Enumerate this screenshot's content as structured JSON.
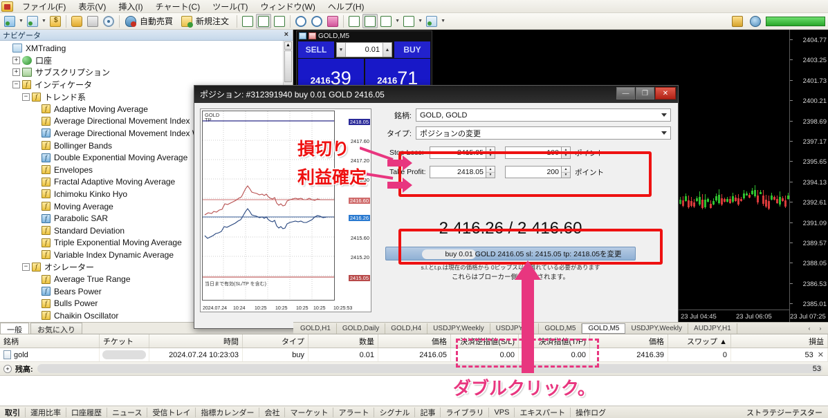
{
  "menu": {
    "items": [
      "ファイル(F)",
      "表示(V)",
      "挿入(I)",
      "チャート(C)",
      "ツール(T)",
      "ウィンドウ(W)",
      "ヘルプ(H)"
    ]
  },
  "toolbar": {
    "auto_trade_label": "自動売買",
    "new_order_label": "新規注文"
  },
  "navigator": {
    "title": "ナビゲータ",
    "close_label": "×",
    "items": [
      {
        "label": "XMTrading",
        "depth": 0,
        "icon": "xm-icon",
        "expander": ""
      },
      {
        "label": "口座",
        "depth": 1,
        "icon": "account-icon",
        "expander": "+"
      },
      {
        "label": "サブスクリプション",
        "depth": 1,
        "icon": "subscription-icon",
        "expander": "+"
      },
      {
        "label": "インディケータ",
        "depth": 1,
        "icon": "function-icon",
        "expander": "−"
      },
      {
        "label": "トレンド系",
        "depth": 2,
        "icon": "function-icon",
        "expander": "−"
      },
      {
        "label": "Adaptive Moving Average",
        "depth": 3,
        "icon": "function-icon",
        "expander": ""
      },
      {
        "label": "Average Directional Movement Index",
        "depth": 3,
        "icon": "function-icon",
        "expander": ""
      },
      {
        "label": "Average Directional Movement Index W",
        "depth": 3,
        "icon": "function-icon",
        "expander": ""
      },
      {
        "label": "Bollinger Bands",
        "depth": 3,
        "icon": "function-icon",
        "expander": ""
      },
      {
        "label": "Double Exponential Moving Average",
        "depth": 3,
        "icon": "function-icon",
        "expander": ""
      },
      {
        "label": "Envelopes",
        "depth": 3,
        "icon": "function-icon",
        "expander": ""
      },
      {
        "label": "Fractal Adaptive Moving Average",
        "depth": 3,
        "icon": "function-icon",
        "expander": ""
      },
      {
        "label": "Ichimoku Kinko Hyo",
        "depth": 3,
        "icon": "function-icon",
        "expander": ""
      },
      {
        "label": "Moving Average",
        "depth": 3,
        "icon": "function-icon",
        "expander": ""
      },
      {
        "label": "Parabolic SAR",
        "depth": 3,
        "icon": "function-icon",
        "expander": ""
      },
      {
        "label": "Standard Deviation",
        "depth": 3,
        "icon": "function-icon",
        "expander": ""
      },
      {
        "label": "Triple Exponential Moving Average",
        "depth": 3,
        "icon": "function-icon",
        "expander": ""
      },
      {
        "label": "Variable Index Dynamic Average",
        "depth": 3,
        "icon": "function-icon",
        "expander": ""
      },
      {
        "label": "オシレーター",
        "depth": 2,
        "icon": "function-icon",
        "expander": "−"
      },
      {
        "label": "Average True Range",
        "depth": 3,
        "icon": "function-icon",
        "expander": ""
      },
      {
        "label": "Bears Power",
        "depth": 3,
        "icon": "function-icon",
        "expander": ""
      },
      {
        "label": "Bulls Power",
        "depth": 3,
        "icon": "function-icon",
        "expander": ""
      },
      {
        "label": "Chaikin Oscillator",
        "depth": 3,
        "icon": "function-icon",
        "expander": ""
      }
    ],
    "tabs": [
      {
        "label": "一般",
        "active": true
      },
      {
        "label": "お気に入り",
        "active": false
      }
    ]
  },
  "trade_panel": {
    "title": "GOLD,M5",
    "sell_label": "SELL",
    "buy_label": "BUY",
    "volume": "0.01",
    "sell_big": "39",
    "sell_small": "2416",
    "buy_big": "71",
    "buy_small": "2416"
  },
  "background_chart": {
    "price_labels": [
      "2404.77",
      "2403.25",
      "2401.73",
      "2400.21",
      "2398.69",
      "2397.17",
      "2395.65",
      "2394.13",
      "2392.61",
      "2391.09",
      "2389.57",
      "2388.05",
      "2386.53",
      "2385.01"
    ],
    "time_labels": [
      "23 Jul 04:45",
      "23 Jul 06:05",
      "23 Jul 07:25"
    ]
  },
  "dialog": {
    "title": "ポジション: #312391940 buy 0.01 GOLD 2416.05",
    "minimize_label": "—",
    "maximize_label": "❐",
    "close_label": "✕",
    "symbol_label": "銘柄:",
    "symbol_value": "GOLD, GOLD",
    "type_label": "タイプ:",
    "type_value": "ポジションの変更",
    "stop_loss_label": "Stop Loss:",
    "stop_loss_price": "2415.05",
    "stop_loss_points": "100",
    "take_profit_label": "Take Profit:",
    "take_profit_price": "2418.05",
    "take_profit_points": "200",
    "points_unit": "ポイント",
    "big_price": "2 416.26 / 2 416.60",
    "modify_button": "buy 0.01 GOLD 2416.05 sl: 2415.05 tp: 2418.05を変更",
    "hint_line1": "s.l.とt.p.は現在の価格から 0ピップス以上離れている必要があります",
    "hint_line2": "これらはブローカー側で処理されます。",
    "chart": {
      "name": "GOLD",
      "tp_tag": "TP",
      "validity": "当日まで有効(SL/TP を含む)",
      "price_labels": [
        "2417.60",
        "2417.20",
        "2416.80",
        "2416.40",
        "2416.00",
        "2415.60",
        "2415.20"
      ],
      "tp_badge": "2418.05",
      "bid_badge": "2416.60",
      "ask_badge": "2416.26",
      "sl_badge": "2415.05",
      "time_labels": [
        "2024.07.24",
        "10:24",
        "10:25",
        "10:25",
        "10:25",
        "10:25",
        "10:25:53"
      ]
    }
  },
  "annotations": {
    "stop_loss_jp": "損切り",
    "take_profit_jp": "利益確定",
    "double_click_jp": "ダブルクリック。"
  },
  "chart_tabs": {
    "items": [
      {
        "label": "GOLD,H1",
        "active": false
      },
      {
        "label": "GOLD,Daily",
        "active": false
      },
      {
        "label": "GOLD,H4",
        "active": false
      },
      {
        "label": "USDJPY,Weekly",
        "active": false
      },
      {
        "label": "USDJPY,H1",
        "active": false
      },
      {
        "label": "GOLD,M5",
        "active": false
      },
      {
        "label": "GOLD,M5",
        "active": true
      },
      {
        "label": "USDJPY,Weekly",
        "active": false
      },
      {
        "label": "AUDJPY,H1",
        "active": false
      }
    ],
    "prev_label": "‹",
    "next_label": "›"
  },
  "terminal": {
    "columns": [
      "銘柄",
      "チケット",
      "時間",
      "タイプ",
      "数量",
      "価格",
      "決済逆指値(S/L)",
      "決済指値(T/P)",
      "価格",
      "スワップ  ▲",
      "損益"
    ],
    "row": {
      "symbol": "gold",
      "ticket": "",
      "time": "2024.07.24 10:23:03",
      "type": "buy",
      "volume": "0.01",
      "price_open": "2416.05",
      "sl": "0.00",
      "tp": "0.00",
      "price_cur": "2416.39",
      "swap": "0",
      "profit": "53"
    },
    "balance_label": "残高:",
    "balance_value": "53",
    "expand_label": "+"
  },
  "status_tabs": {
    "items": [
      "取引",
      "運用比率",
      "口座履歴",
      "ニュース",
      "受信トレイ",
      "指標カレンダー",
      "会社",
      "マーケット",
      "アラート",
      "シグナル",
      "記事",
      "ライブラリ",
      "VPS",
      "エキスパート",
      "操作ログ"
    ],
    "right_label": "ストラテジーテスター"
  },
  "colors": {
    "annotation_red": "#ee1111",
    "annotation_pink": "#e8367f",
    "buy_blue": "#1818c8",
    "chart_bg": "#000000"
  }
}
